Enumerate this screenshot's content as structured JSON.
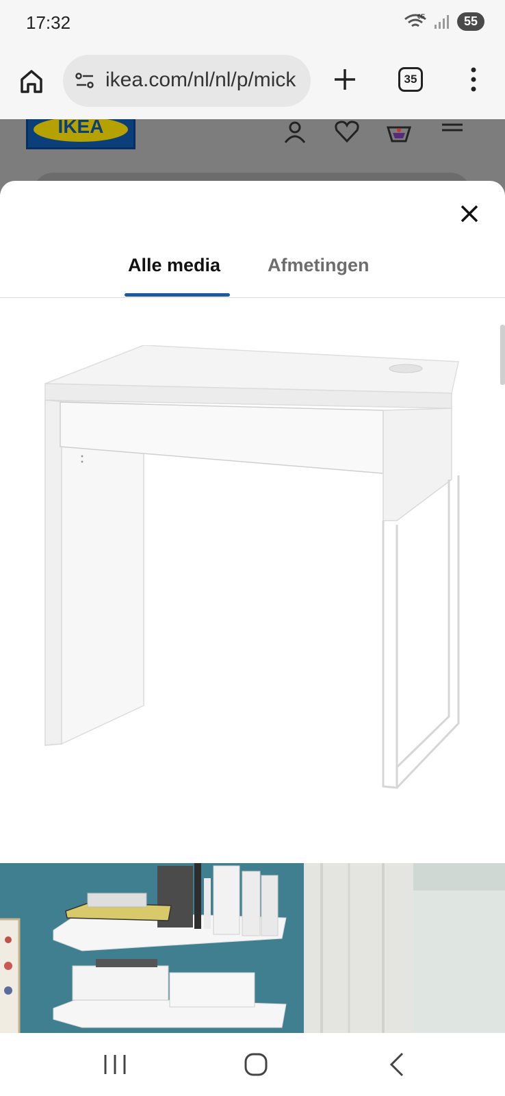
{
  "status_bar": {
    "time": "17:32",
    "network_label": "6E",
    "battery": "55"
  },
  "browser": {
    "url": "ikea.com/nl/nl/p/mick",
    "tab_count": "35"
  },
  "page_header": {
    "logo_text": "IKEA"
  },
  "media_sheet": {
    "tabs": [
      {
        "label": "Alle media",
        "active": true
      },
      {
        "label": "Afmetingen",
        "active": false
      }
    ],
    "accent_color": "#1a5aa0"
  },
  "icons": {
    "home": "home-icon",
    "site_settings": "site-settings-icon",
    "new_tab": "plus-icon",
    "menu": "more-vertical-icon",
    "account": "person-icon",
    "favourites": "heart-icon",
    "cart": "shopping-bag-icon",
    "nav_menu": "hamburger-icon",
    "close": "close-icon"
  }
}
